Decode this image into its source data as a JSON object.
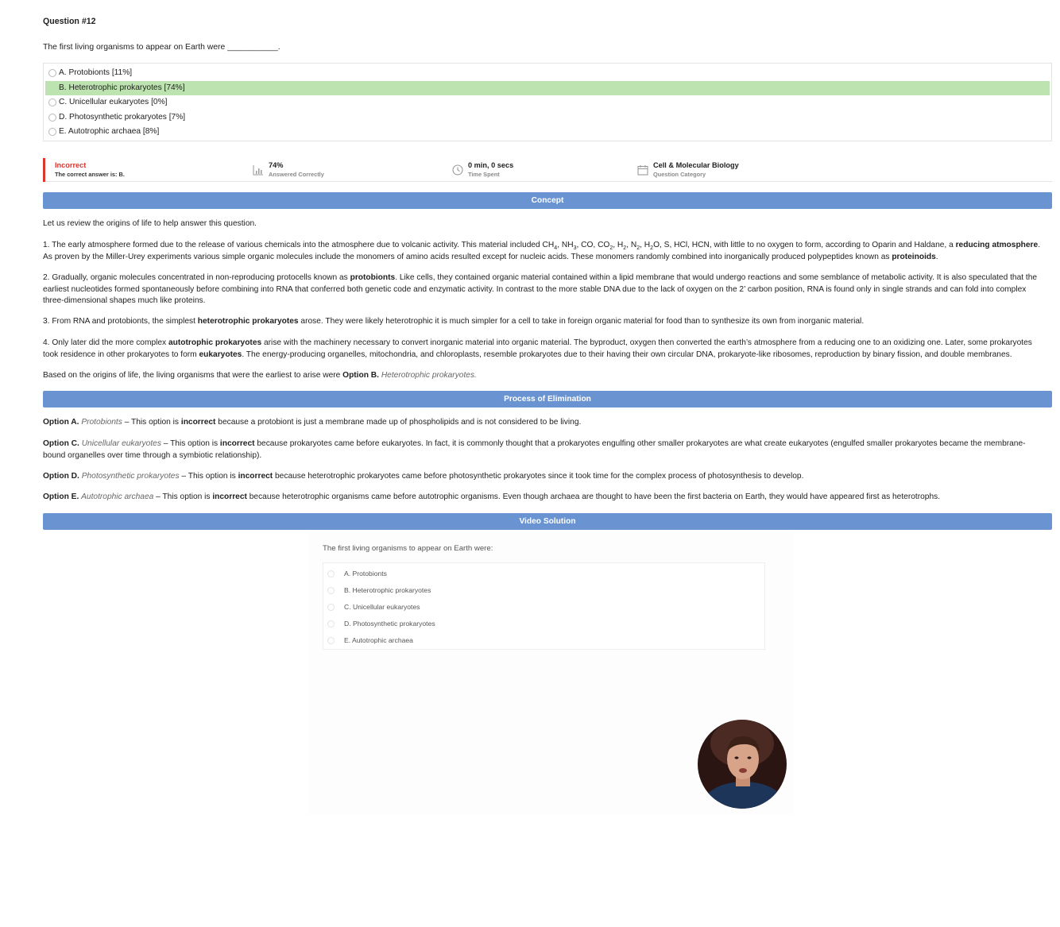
{
  "question": {
    "number": "Question #12",
    "text": "The first living organisms to appear on Earth were ___________."
  },
  "options": [
    {
      "label": "A. Protobionts [11%]",
      "correct": false
    },
    {
      "label": "B. Heterotrophic prokaryotes [74%]",
      "correct": true
    },
    {
      "label": "C. Unicellular eukaryotes [0%]",
      "correct": false
    },
    {
      "label": "D. Photosynthetic prokaryotes [7%]",
      "correct": false
    },
    {
      "label": "E. Autotrophic archaea [8%]",
      "correct": false
    }
  ],
  "stats": {
    "result": "Incorrect",
    "correct_answer": "The correct answer is: B.",
    "percent": "74%",
    "percent_label": "Answered Correctly",
    "time": "0 min, 0 secs",
    "time_label": "Time Spent",
    "category": "Cell & Molecular Biology",
    "category_label": "Question Category"
  },
  "sections": {
    "concept": "Concept",
    "elimination": "Process of Elimination",
    "video": "Video Solution"
  },
  "concept": {
    "intro": "Let us review the origins of life to help answer this question.",
    "p1": {
      "a": "1. The early atmosphere formed due to the release of various chemicals into the atmosphere due to volcanic activity. This material included CH",
      "s1": "4",
      "b": ", NH",
      "s2": "3",
      "c": ", CO, CO",
      "s3": "2",
      "d": ", H",
      "s4": "2",
      "e": ", N",
      "s5": "2",
      "f": ", H",
      "s6": "2",
      "g": "O, S, HCl, HCN, with little to no oxygen to form, according to Oparin and Haldane, a ",
      "b1": "reducing atmosphere",
      "h": ". As proven by the Miller-Urey experiments various simple organic molecules include the monomers of amino acids resulted except for nucleic acids. These monomers randomly combined into inorganically produced polypeptides known as ",
      "b2": "proteinoids",
      "i": "."
    },
    "p2": {
      "a": "2. Gradually, organic molecules concentrated in non-reproducing protocells known as ",
      "b1": "protobionts",
      "b": ". Like cells, they contained organic material contained within a lipid membrane that would undergo reactions and some semblance of metabolic activity. It is also speculated that the earliest nucleotides formed spontaneously before combining into RNA that conferred both genetic code and enzymatic activity. In contrast to the more stable DNA due to the lack of oxygen on the 2’ carbon position, RNA is found only in single strands and can fold into complex three-dimensional shapes much like proteins."
    },
    "p3": {
      "a": "3. From RNA and protobionts, the simplest ",
      "b1": "heterotrophic prokaryotes",
      "b": " arose. They were likely heterotrophic it is much simpler for a cell to take in foreign organic material for food than to synthesize its own from inorganic material."
    },
    "p4": {
      "a": "4. Only later did the more complex ",
      "b1": "autotrophic prokaryotes",
      "b": " arise with the machinery necessary to convert inorganic material into organic material. The byproduct, oxygen then converted the earth’s atmosphere from a reducing one to an oxidizing one. Later, some prokaryotes took residence in other prokaryotes to form ",
      "b2": "eukaryotes",
      "c": ". The energy-producing organelles, mitochondria, and chloroplasts, resemble prokaryotes due to their having their own circular DNA, prokaryote-like ribosomes, reproduction by binary fission, and double membranes."
    },
    "conclusion": {
      "a": "Based on the origins of life, the living organisms that were the earliest to arise were ",
      "b1": "Option B.",
      "i1": "Heterotrophic prokaryotes."
    }
  },
  "elimination": [
    {
      "opt": "Option A.",
      "name": "Protobionts",
      "a": " – This option is ",
      "b": "incorrect",
      "c": " because a protobiont is just a membrane made up of phospholipids and is not considered to be living."
    },
    {
      "opt": "Option C.",
      "name": "Unicellular eukaryotes",
      "a": " – This option is ",
      "b": "incorrect",
      "c": " because prokaryotes came before eukaryotes. In fact, it is commonly thought that a prokaryotes engulfing other smaller prokaryotes are what create eukaryotes (engulfed smaller prokaryotes became the membrane-bound organelles over time through a symbiotic relationship)."
    },
    {
      "opt": "Option D.",
      "name": "Photosynthetic prokaryotes",
      "a": " – This option is ",
      "b": "incorrect",
      "c": " because heterotrophic prokaryotes came before photosynthetic prokaryotes since it took time for the complex process of photosynthesis to develop."
    },
    {
      "opt": "Option E.",
      "name": "Autotrophic archaea",
      "a": " – This option is ",
      "b": "incorrect",
      "c": " because heterotrophic organisms came before autotrophic organisms. Even though archaea are thought to have been the first bacteria on Earth, they would have appeared first as heterotrophs."
    }
  ],
  "video": {
    "question": "The first living organisms to appear on Earth were:",
    "options": [
      "A. Protobionts",
      "B. Heterotrophic prokaryotes",
      "C. Unicellular eukaryotes",
      "D. Photosynthetic prokaryotes",
      "E. Autotrophic archaea"
    ]
  },
  "colors": {
    "accent_band": "#6994d1",
    "correct_bg": "#bde3b0",
    "incorrect": "#d9372f"
  },
  "icons": [
    "bar-chart-icon",
    "clock-icon",
    "calendar-icon",
    "presenter-avatar"
  ]
}
